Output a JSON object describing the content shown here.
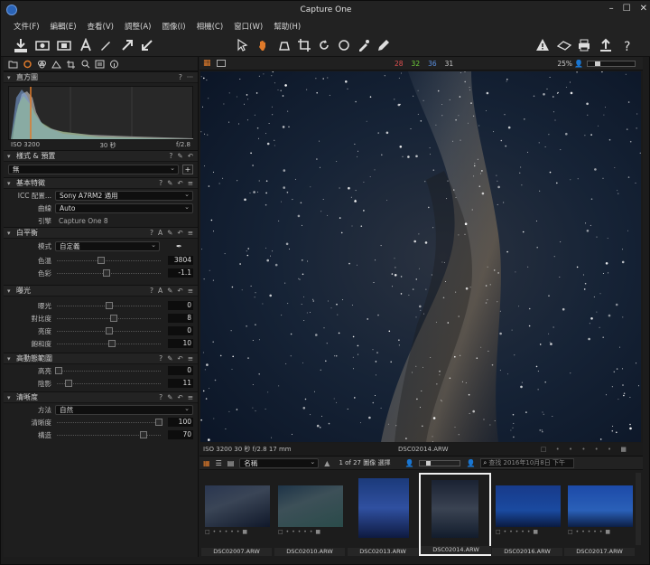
{
  "window": {
    "title": "Capture One"
  },
  "menu": [
    "文件(F)",
    "編輯(E)",
    "查看(V)",
    "調整(A)",
    "圖像(I)",
    "相機(C)",
    "窗口(W)",
    "幫助(H)"
  ],
  "viewer": {
    "counts": {
      "c1": "28",
      "c2": "32",
      "c3": "36",
      "c4": "31"
    },
    "zoom": "25%",
    "caption_left": "ISO 3200  30 秒  f/2.8  17 mm",
    "caption_center": "DSC02014.ARW"
  },
  "histogram": {
    "title": "直方圖",
    "iso": "ISO 3200",
    "shutter": "30 秒",
    "aperture": "f/2.8"
  },
  "styles": {
    "title": "樣式 & 預置",
    "value": "無"
  },
  "basic": {
    "title": "基本特徵",
    "icc_label": "ICC 配置...",
    "icc_value": "Sony A7RM2 通用",
    "curve_label": "曲線",
    "curve_value": "Auto",
    "engine_label": "引擎",
    "engine_value": "Capture One 8"
  },
  "wb": {
    "title": "白平衡",
    "mode_label": "模式",
    "mode_value": "自定義",
    "temp_label": "色溫",
    "temp_value": "3804",
    "temp_pos": 0.42,
    "tint_label": "色彩",
    "tint_value": "-1.1",
    "tint_pos": 0.48
  },
  "exposure": {
    "title": "曝光",
    "rows": [
      {
        "label": "曝光",
        "value": "0",
        "pos": 0.5
      },
      {
        "label": "對比度",
        "value": "8",
        "pos": 0.55
      },
      {
        "label": "亮度",
        "value": "0",
        "pos": 0.5
      },
      {
        "label": "飽和度",
        "value": "10",
        "pos": 0.53
      }
    ]
  },
  "hdr": {
    "title": "高動態範圍",
    "rows": [
      {
        "label": "高亮",
        "value": "0",
        "pos": 0.0
      },
      {
        "label": "陰影",
        "value": "11",
        "pos": 0.1
      }
    ]
  },
  "clarity": {
    "title": "清晰度",
    "method_label": "方法",
    "method_value": "自然",
    "rows": [
      {
        "label": "清晰度",
        "value": "100",
        "pos": 1.0
      },
      {
        "label": "構造",
        "value": "70",
        "pos": 0.85
      }
    ]
  },
  "browser": {
    "sort": "名稱",
    "counter": "1 of 27 圖像 選擇",
    "search_placeholder": "查找 2016年10月8日 下午",
    "thumbs": [
      "DSC02007.ARW",
      "DSC02010.ARW",
      "DSC02013.ARW",
      "DSC02014.ARW",
      "DSC02016.ARW",
      "DSC02017.ARW"
    ]
  },
  "colors": {
    "accent": "#e07a2a",
    "count1": "#e05050",
    "count2": "#6fcf3a",
    "count3": "#5a8fe0",
    "count4": "#c8c8c8"
  }
}
